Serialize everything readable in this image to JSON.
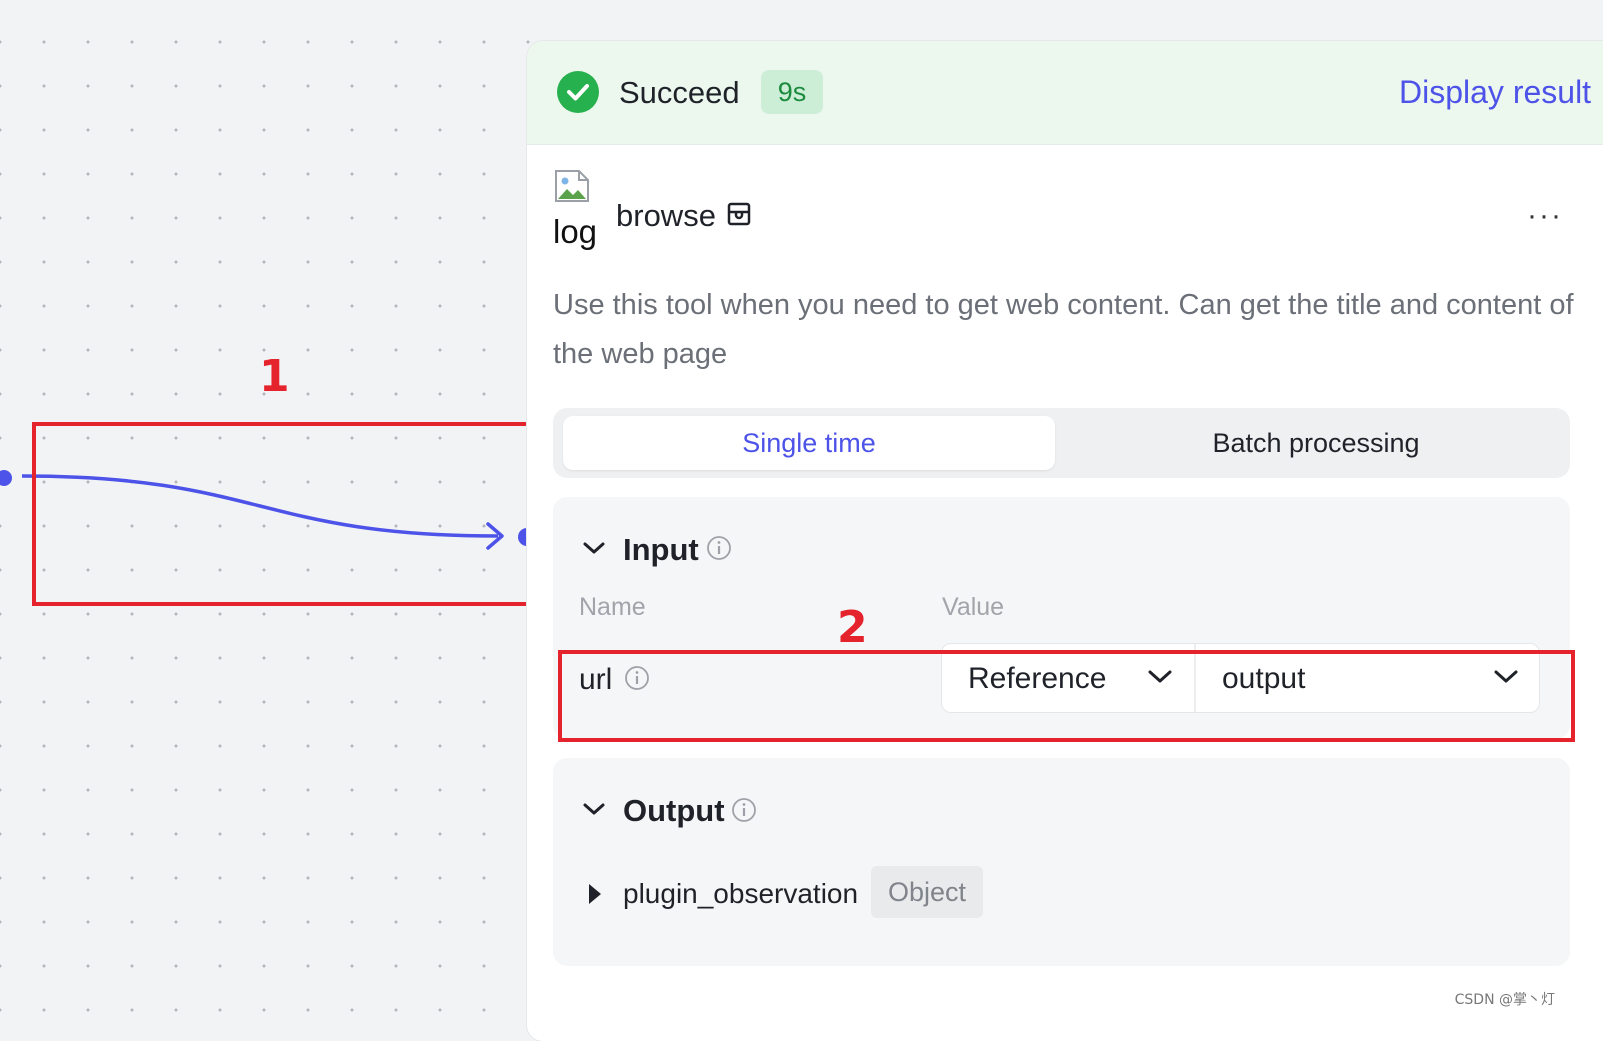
{
  "status": {
    "label": "Succeed",
    "duration": "9s",
    "display_result_label": "Display result",
    "color": "#26b14e"
  },
  "plugin": {
    "logo_alt_text": "log",
    "name": "browse",
    "name_icon": "store-icon",
    "more_label": "···",
    "description": "Use this tool when you need to get web content. Can get the title and content of the web page"
  },
  "tabs": [
    {
      "label": "Single time",
      "active": true
    },
    {
      "label": "Batch processing",
      "active": false
    }
  ],
  "input_section": {
    "title": "Input",
    "columns": {
      "name": "Name",
      "value": "Value"
    },
    "params": [
      {
        "name": "url",
        "source_type": "Reference",
        "source_value": "output"
      }
    ]
  },
  "output_section": {
    "title": "Output",
    "fields": [
      {
        "name": "plugin_observation",
        "type": "Object"
      }
    ]
  },
  "annotations": [
    {
      "number": "1"
    },
    {
      "number": "2"
    }
  ],
  "edge_color": "#4d53e8",
  "annotation_color": "#e5232d",
  "accent_color": "#4d53e8",
  "watermark": "CSDN @掌丶灯"
}
